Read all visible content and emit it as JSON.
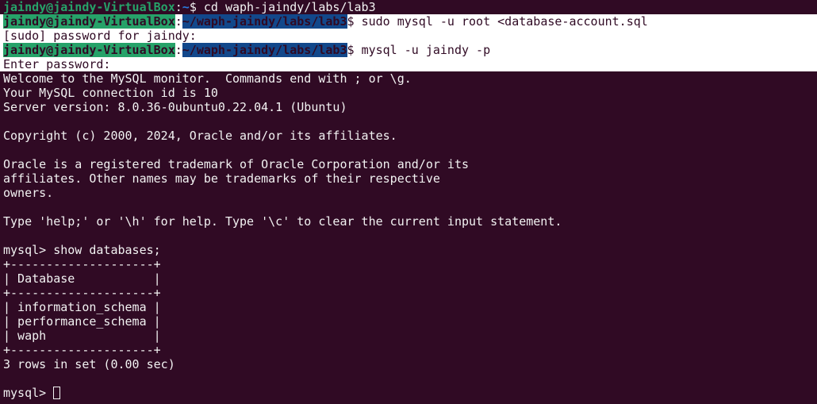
{
  "prompt": {
    "user": "jaindy@jaindy-VirtualBox",
    "colon": ":",
    "home": "~",
    "path": "~/waph-jaindy/labs/lab3",
    "dollar": "$ "
  },
  "commands": {
    "cd": "cd waph-jaindy/labs/lab3",
    "sudo": "sudo mysql -u root <database-account.sql",
    "mysql": "mysql -u jaindy -p"
  },
  "output": [
    "[sudo] password for jaindy:",
    "Enter password:",
    "Welcome to the MySQL monitor.  Commands end with ; or \\g.",
    "Your MySQL connection id is 10",
    "Server version: 8.0.36-0ubuntu0.22.04.1 (Ubuntu)",
    "",
    "Copyright (c) 2000, 2024, Oracle and/or its affiliates.",
    "",
    "Oracle is a registered trademark of Oracle Corporation and/or its",
    "affiliates. Other names may be trademarks of their respective",
    "owners.",
    "",
    "Type 'help;' or '\\h' for help. Type '\\c' to clear the current input statement.",
    "",
    "mysql> show databases;",
    "+--------------------+",
    "| Database           |",
    "+--------------------+",
    "| information_schema |",
    "| performance_schema |",
    "| waph               |",
    "+--------------------+",
    "3 rows in set (0.00 sec)",
    ""
  ],
  "final_prompt": "mysql> "
}
